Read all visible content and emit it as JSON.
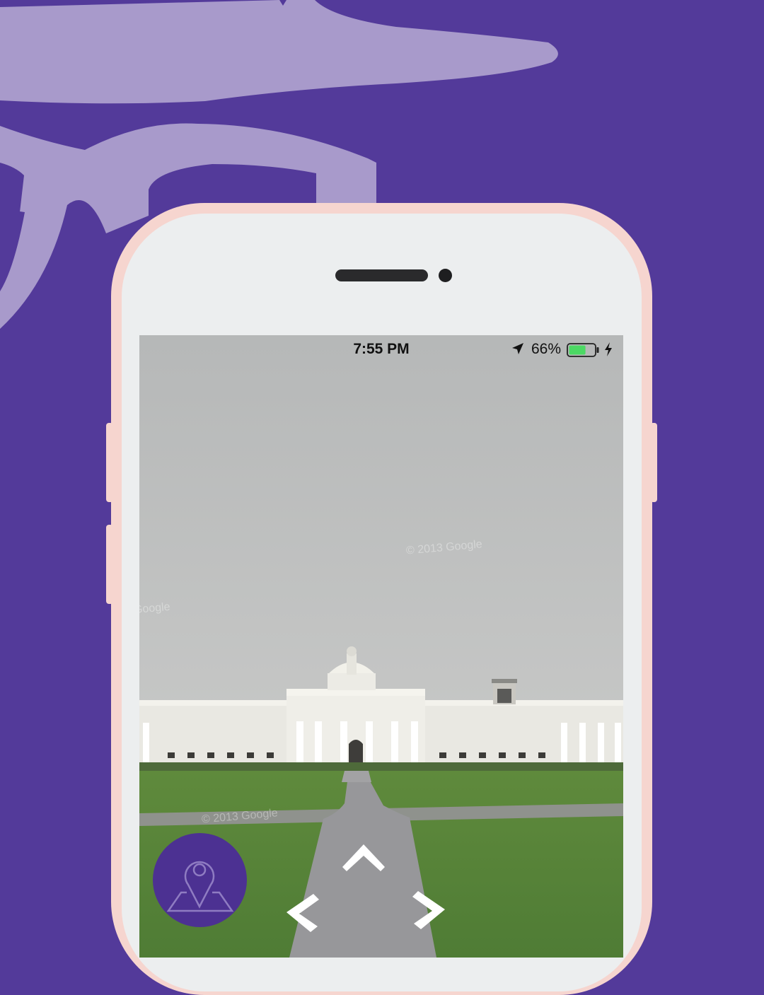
{
  "colors": {
    "background": "#533a9a",
    "decoration": "#a89acb",
    "phone_frame": "#f6d5cf",
    "phone_face": "#eceeef",
    "map_button": "#4c3192",
    "battery_fill": "#4cd964"
  },
  "status_bar": {
    "time": "7:55 PM",
    "battery_percent": "66%",
    "battery_level": 0.66,
    "location_icon": "location-arrow-icon",
    "charging_icon": "bolt-icon"
  },
  "street_view": {
    "watermarks": [
      "© 2013 Google",
      "© 2013 Google",
      "Google"
    ]
  },
  "controls": {
    "map_button_icon": "map-pin-icon",
    "arrows": [
      "forward-arrow-icon",
      "left-arrow-icon",
      "right-arrow-icon"
    ]
  }
}
